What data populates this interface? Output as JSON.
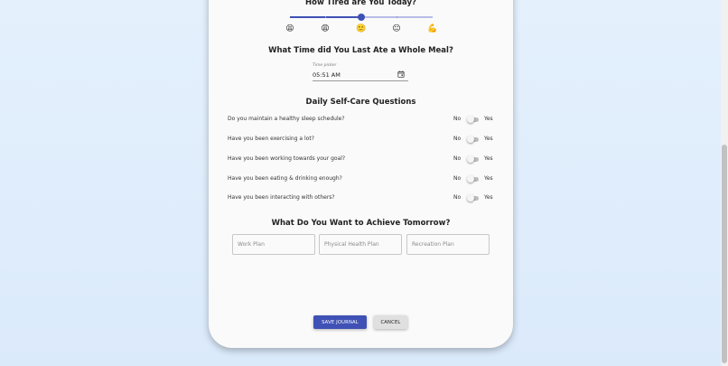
{
  "tiredness": {
    "heading": "How Tired are You Today?",
    "value_index": 2,
    "levels": 5,
    "emojis": [
      "😫",
      "😩",
      "🙂",
      "😐",
      "💪"
    ]
  },
  "meal_time": {
    "heading": "What Time did You Last Ate a Whole Meal?",
    "label": "Time picker",
    "value": "05:51 AM"
  },
  "self_care": {
    "heading": "Daily Self-Care Questions",
    "no_label": "No",
    "yes_label": "Yes",
    "questions": [
      "Do you maintain a healthy sleep schedule?",
      "Have you been exercising a lot?",
      "Have you been working towards your goal?",
      "Have you been eating & drinking enough?",
      "Have you been interacting with others?"
    ]
  },
  "tomorrow": {
    "heading": "What Do You Want to Achieve Tomorrow?",
    "work_placeholder": "Work Plan",
    "health_placeholder": "Physical Health Plan",
    "recreation_placeholder": "Recreation Plan"
  },
  "actions": {
    "save_label": "SAVE JOURNAL",
    "cancel_label": "CANCEL"
  },
  "colors": {
    "primary": "#3f51b5",
    "page_background": "#dbeafb",
    "card": "#fafafa"
  }
}
